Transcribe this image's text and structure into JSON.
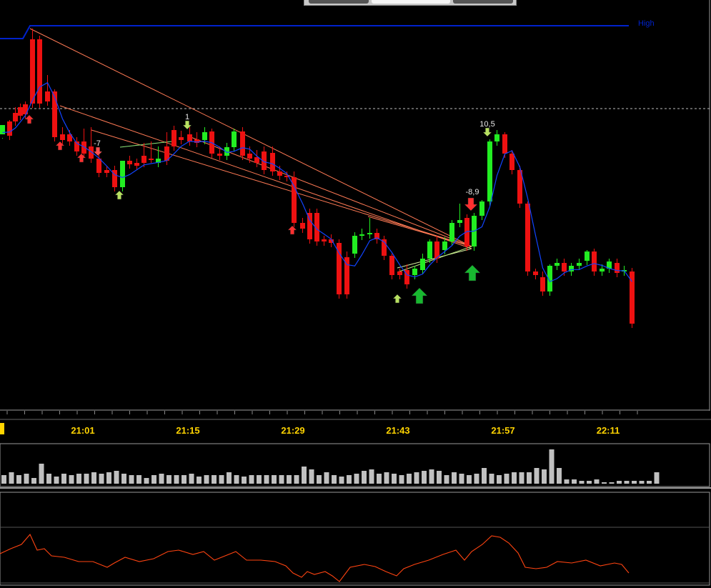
{
  "window": {
    "toolbar_segments": 3
  },
  "colors": {
    "background": "#000000",
    "bull": "#22ee22",
    "bear": "#ee1111",
    "high_line": "#0022cc",
    "ma_line": "#1144ff",
    "trend_line": "#ff7a55",
    "axis_text": "#ffd400",
    "volume": "#c0c0c0",
    "oscillator": "#ff4411"
  },
  "main_panel": {
    "high_label": "High",
    "annotations": [
      {
        "text": "-7"
      },
      {
        "text": "1"
      },
      {
        "text": "10,5"
      },
      {
        "text": "-8,9"
      }
    ]
  },
  "time_axis": {
    "labels": [
      "21:01",
      "21:15",
      "21:29",
      "21:43",
      "21:57",
      "22:11"
    ]
  },
  "chart_data": {
    "type": "candlestick",
    "title": "",
    "xlabel": "",
    "ylabel": "",
    "x_tick_labels": [
      "21:01",
      "21:15",
      "21:29",
      "21:43",
      "21:57",
      "22:11"
    ],
    "series": [
      {
        "name": "High",
        "type": "line"
      }
    ],
    "panels": [
      "price",
      "volume",
      "oscillator"
    ],
    "grid": false,
    "legend": "none"
  }
}
